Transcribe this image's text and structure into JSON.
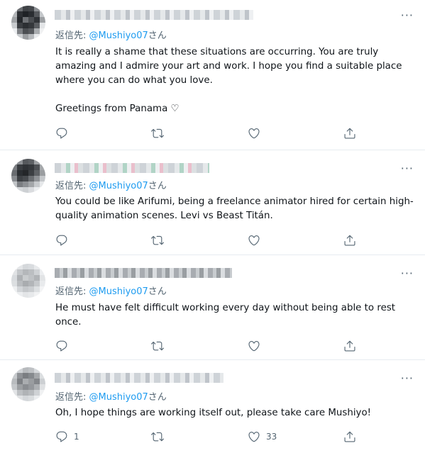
{
  "tweets": [
    {
      "reply_prefix": "返信先: ",
      "reply_handle": "@Mushiyo07",
      "reply_suffix": "さん",
      "text": "It is really a shame that these situations are occurring.  You are truly amazing and I admire your art and work.  I hope you find a suitable place where you can do what you love.\n\nGreetings from Panama ♡",
      "reply_count": "",
      "retweet_count": "",
      "like_count": ""
    },
    {
      "reply_prefix": "返信先: ",
      "reply_handle": "@Mushiyo07",
      "reply_suffix": "さん",
      "text": "You could be like Arifumi, being a freelance animator hired for certain high-quality animation scenes. Levi vs Beast Titán.",
      "reply_count": "",
      "retweet_count": "",
      "like_count": ""
    },
    {
      "reply_prefix": "返信先: ",
      "reply_handle": "@Mushiyo07",
      "reply_suffix": "さん",
      "text": "He must have felt difficult working every day without being able to rest once.",
      "reply_count": "",
      "retweet_count": "",
      "like_count": ""
    },
    {
      "reply_prefix": "返信先: ",
      "reply_handle": "@Mushiyo07",
      "reply_suffix": "さん",
      "text": "Oh, I hope things are working itself out, please take care Mushiyo!",
      "reply_count": "1",
      "retweet_count": "",
      "like_count": "33"
    }
  ],
  "more_label": "···",
  "icons": {
    "reply": "reply-icon",
    "retweet": "retweet-icon",
    "like": "heart-icon",
    "share": "share-icon",
    "more": "more-icon"
  },
  "colors": {
    "link": "#1d9bf0",
    "muted": "#536471",
    "text": "#0f1419",
    "divider": "#e6ecf0"
  }
}
